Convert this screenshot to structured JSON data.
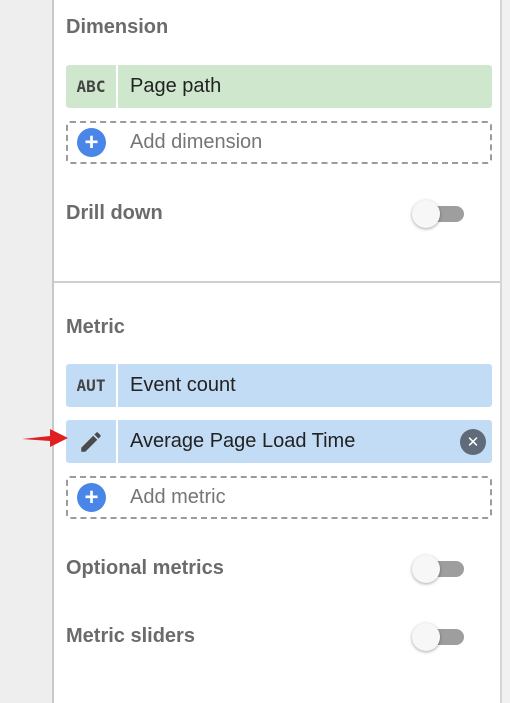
{
  "dimension": {
    "title": "Dimension",
    "chip": {
      "type": "ABC",
      "label": "Page path"
    },
    "add_label": "Add dimension",
    "add_icon": "+",
    "drill_down": {
      "label": "Drill down",
      "enabled": false
    }
  },
  "metric": {
    "title": "Metric",
    "chips": [
      {
        "type": "AUT",
        "label": "Event count"
      },
      {
        "type": "pencil-icon",
        "label": "Average Page Load Time",
        "remove_icon": "✕"
      }
    ],
    "add_label": "Add metric",
    "add_icon": "+",
    "optional_metrics": {
      "label": "Optional metrics",
      "enabled": false
    },
    "metric_sliders": {
      "label": "Metric sliders",
      "enabled": false
    }
  },
  "colors": {
    "dimension_chip": "#cfe8cd",
    "metric_chip": "#c3dcf5",
    "add_icon": "#4a86e8",
    "arrow": "#e02020"
  }
}
